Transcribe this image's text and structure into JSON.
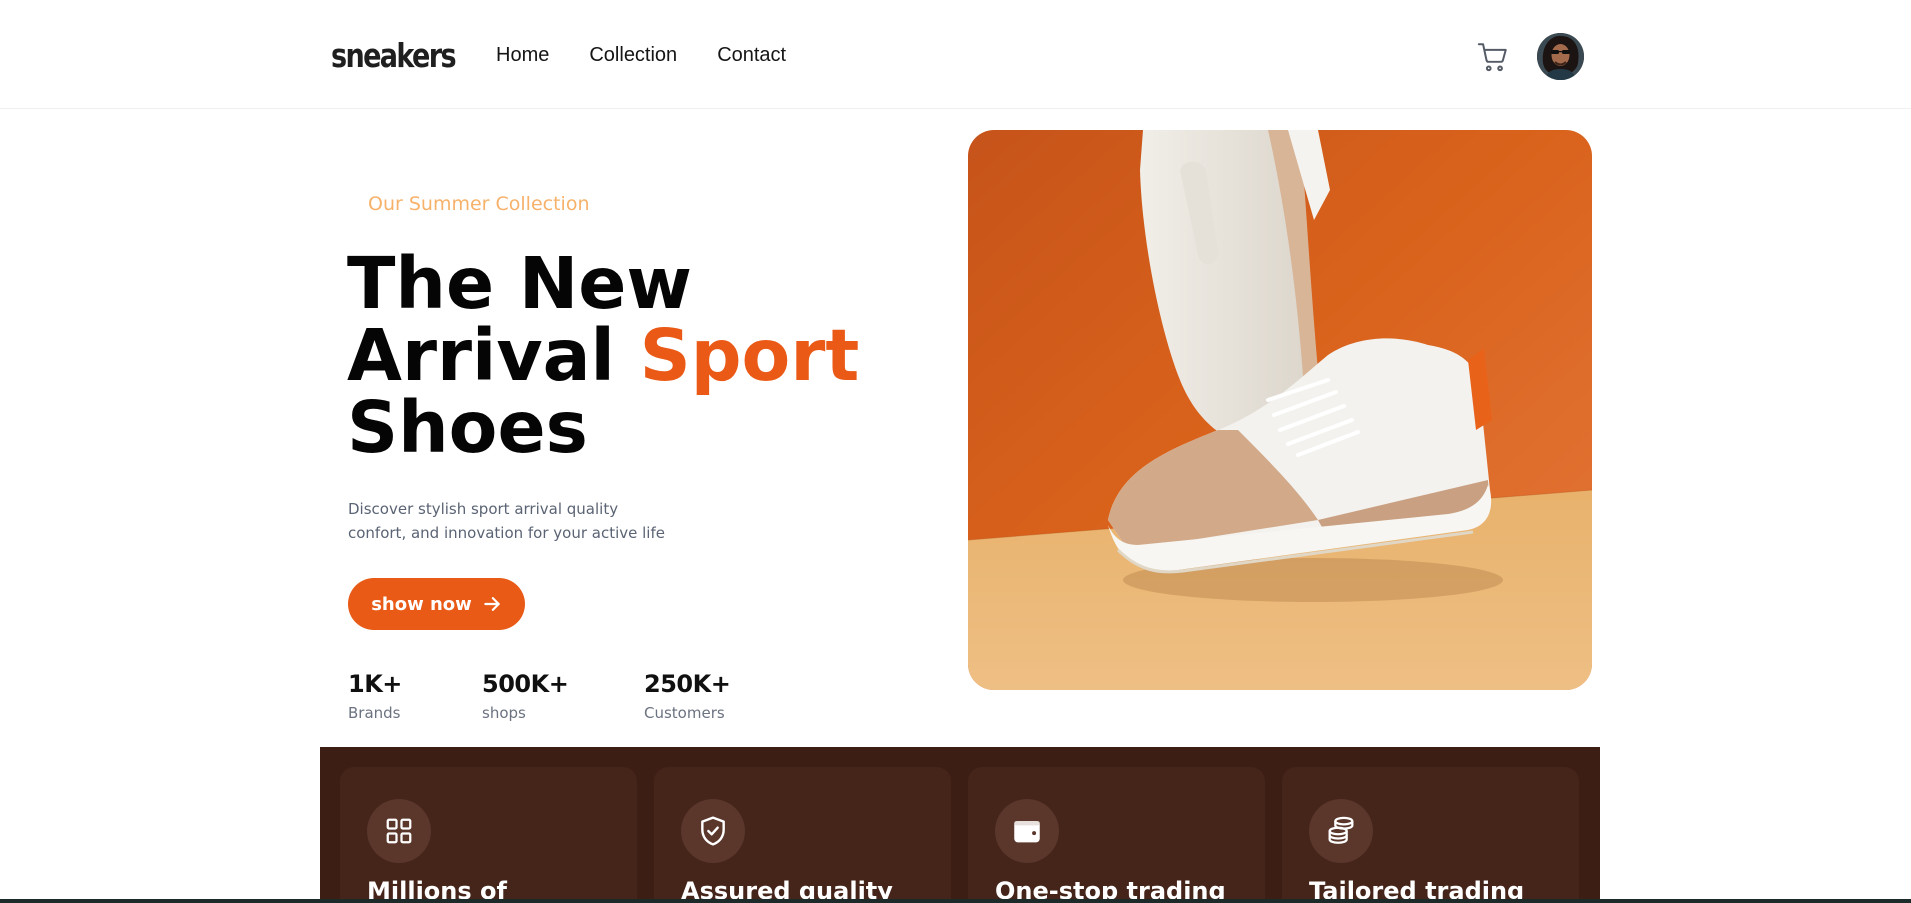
{
  "header": {
    "logo": "sneakers",
    "nav": [
      "Home",
      "Collection",
      "Contact"
    ],
    "cart_icon": "cart-icon",
    "avatar_icon": "avatar"
  },
  "hero": {
    "eyebrow": "Our Summer Collection",
    "title_line1": "The New",
    "title_line2a": "Arrival ",
    "title_line2b": "Sport",
    "title_line3": "Shoes",
    "description_line1": "Discover stylish sport arrival quality",
    "description_line2": "confort, and innovation for your active life",
    "cta_label": "show now",
    "cta_icon": "arrow-right-icon",
    "stats": [
      {
        "value": "1K+",
        "label": "Brands"
      },
      {
        "value": "500K+",
        "label": "shops"
      },
      {
        "value": "250K+",
        "label": "Customers"
      }
    ]
  },
  "colors": {
    "accent": "#ea5a16",
    "eyebrow": "#f6b26b",
    "features_bg": "#3d1e15",
    "card_bg": "#45241a"
  },
  "features": [
    {
      "title": "Millions of",
      "icon": "grid-icon"
    },
    {
      "title": "Assured quality",
      "icon": "shield-check-icon"
    },
    {
      "title": "One-stop trading",
      "icon": "wallet-icon"
    },
    {
      "title": "Tailored trading",
      "icon": "coins-icon"
    }
  ]
}
